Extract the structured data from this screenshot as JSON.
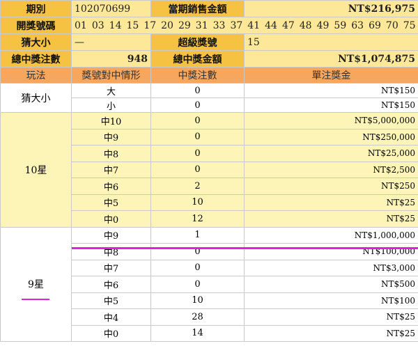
{
  "info": {
    "period_label": "期別",
    "period_value": "102070699",
    "sales_label": "當期銷售金額",
    "sales_value": "NT$216,975",
    "numbers_label": "開獎號碼",
    "numbers": [
      "01",
      "03",
      "14",
      "15",
      "17",
      "20",
      "29",
      "31",
      "33",
      "37",
      "41",
      "44",
      "47",
      "48",
      "49",
      "59",
      "63",
      "69",
      "70",
      "75"
    ],
    "bigsmall_label": "猜大小",
    "bigsmall_value": "—",
    "super_label": "超級獎號",
    "super_value": "15",
    "total_bets_label": "總中獎注數",
    "total_bets_value": "948",
    "total_prize_label": "總中獎金額",
    "total_prize_value": "NT$1,074,875"
  },
  "columns": [
    "玩法",
    "獎號對中情形",
    "中獎注數",
    "單注獎金"
  ],
  "groups": [
    {
      "play": "猜大小",
      "rows": [
        {
          "match": "大",
          "count": "0",
          "prize": "NT$150"
        },
        {
          "match": "小",
          "count": "0",
          "prize": "NT$150"
        }
      ]
    },
    {
      "play": "10星",
      "rows": [
        {
          "match": "中10",
          "count": "0",
          "prize": "NT$5,000,000"
        },
        {
          "match": "中9",
          "count": "0",
          "prize": "NT$250,000"
        },
        {
          "match": "中8",
          "count": "0",
          "prize": "NT$25,000"
        },
        {
          "match": "中7",
          "count": "0",
          "prize": "NT$2,500"
        },
        {
          "match": "中6",
          "count": "2",
          "prize": "NT$250"
        },
        {
          "match": "中5",
          "count": "10",
          "prize": "NT$25"
        },
        {
          "match": "中0",
          "count": "12",
          "prize": "NT$25"
        }
      ]
    },
    {
      "play": "9星",
      "rows": [
        {
          "match": "中9",
          "count": "1",
          "prize": "NT$1,000,000"
        },
        {
          "match": "中8",
          "count": "0",
          "prize": "NT$100,000"
        },
        {
          "match": "中7",
          "count": "0",
          "prize": "NT$3,000"
        },
        {
          "match": "中6",
          "count": "0",
          "prize": "NT$500"
        },
        {
          "match": "中5",
          "count": "10",
          "prize": "NT$100"
        },
        {
          "match": "中4",
          "count": "28",
          "prize": "NT$25"
        },
        {
          "match": "中0",
          "count": "14",
          "prize": "NT$25"
        }
      ]
    }
  ],
  "colors": {
    "label_bg": "#f5c242",
    "value_bg": "#fde89a",
    "column_header_bg": "#f7a65e",
    "ten_star_bg": "#fdf4b8",
    "highlight_line": "#e020e0"
  }
}
